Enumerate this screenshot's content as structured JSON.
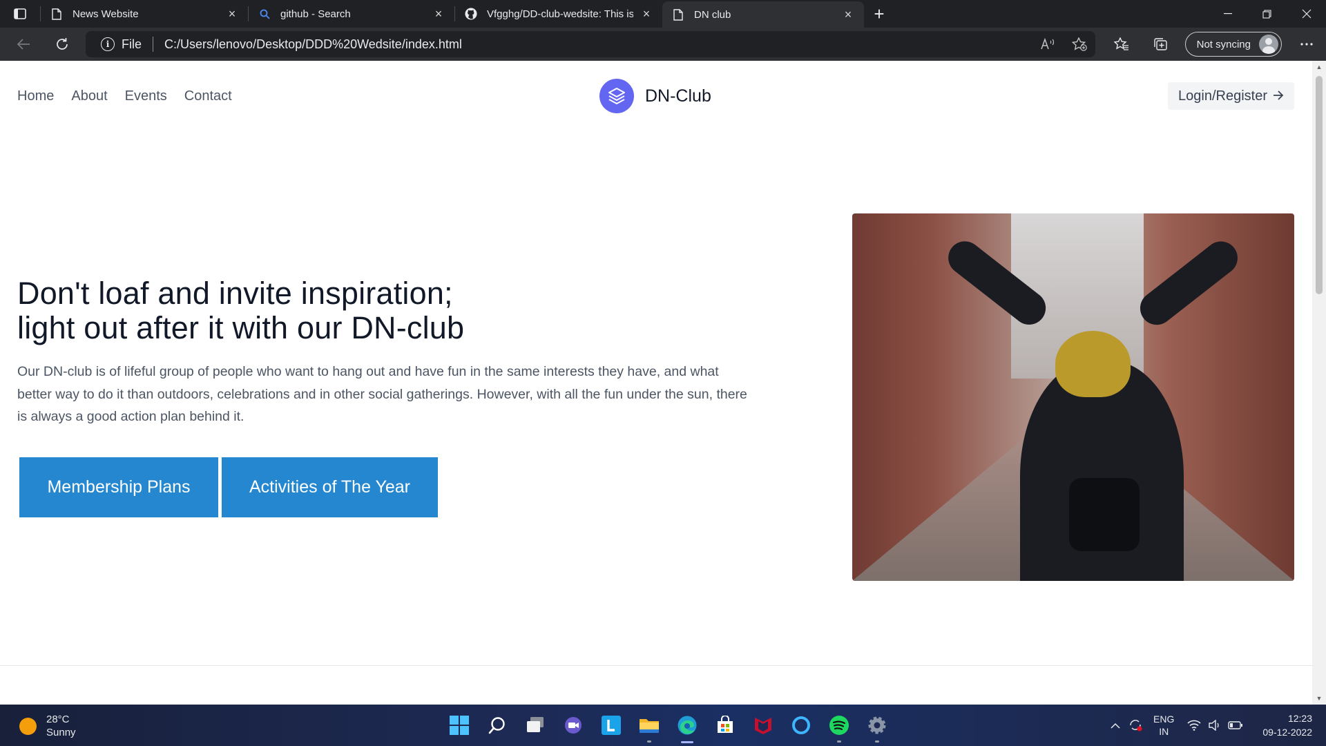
{
  "browser": {
    "tabs": [
      {
        "title": "News Website",
        "icon": "page-icon",
        "active": false
      },
      {
        "title": "github - Search",
        "icon": "search-icon",
        "active": false
      },
      {
        "title": "Vfgghg/DD-club-wedsite: This is",
        "icon": "github-icon",
        "active": false
      },
      {
        "title": "DN club",
        "icon": "page-icon",
        "active": true
      }
    ],
    "address": {
      "scheme_label": "File",
      "url": "C:/Users/lenovo/Desktop/DDD%20Wedsite/index.html"
    },
    "sync_label": "Not syncing"
  },
  "site": {
    "nav": [
      "Home",
      "About",
      "Events",
      "Contact"
    ],
    "brand": "DN-Club",
    "login_label": "Login/Register",
    "accent_color": "#6366f1",
    "hero": {
      "title_line1": "Don't loaf and invite inspiration;",
      "title_line2": "light out after it with our DN-club",
      "description": "Our DN-club is of lifeful group of people who want to hang out and have fun in the same interests they have, and what better way to do it than outdoors, celebrations and in other social gatherings. However, with all the fun under the sun, there is always a good action plan behind it.",
      "buttons": [
        "Membership Plans",
        "Activities of The Year"
      ],
      "button_color": "#2587cf"
    }
  },
  "taskbar": {
    "weather": {
      "temp": "28°C",
      "condition": "Sunny"
    },
    "language": {
      "line1": "ENG",
      "line2": "IN"
    },
    "clock": {
      "time": "12:23",
      "date": "09-12-2022"
    }
  }
}
